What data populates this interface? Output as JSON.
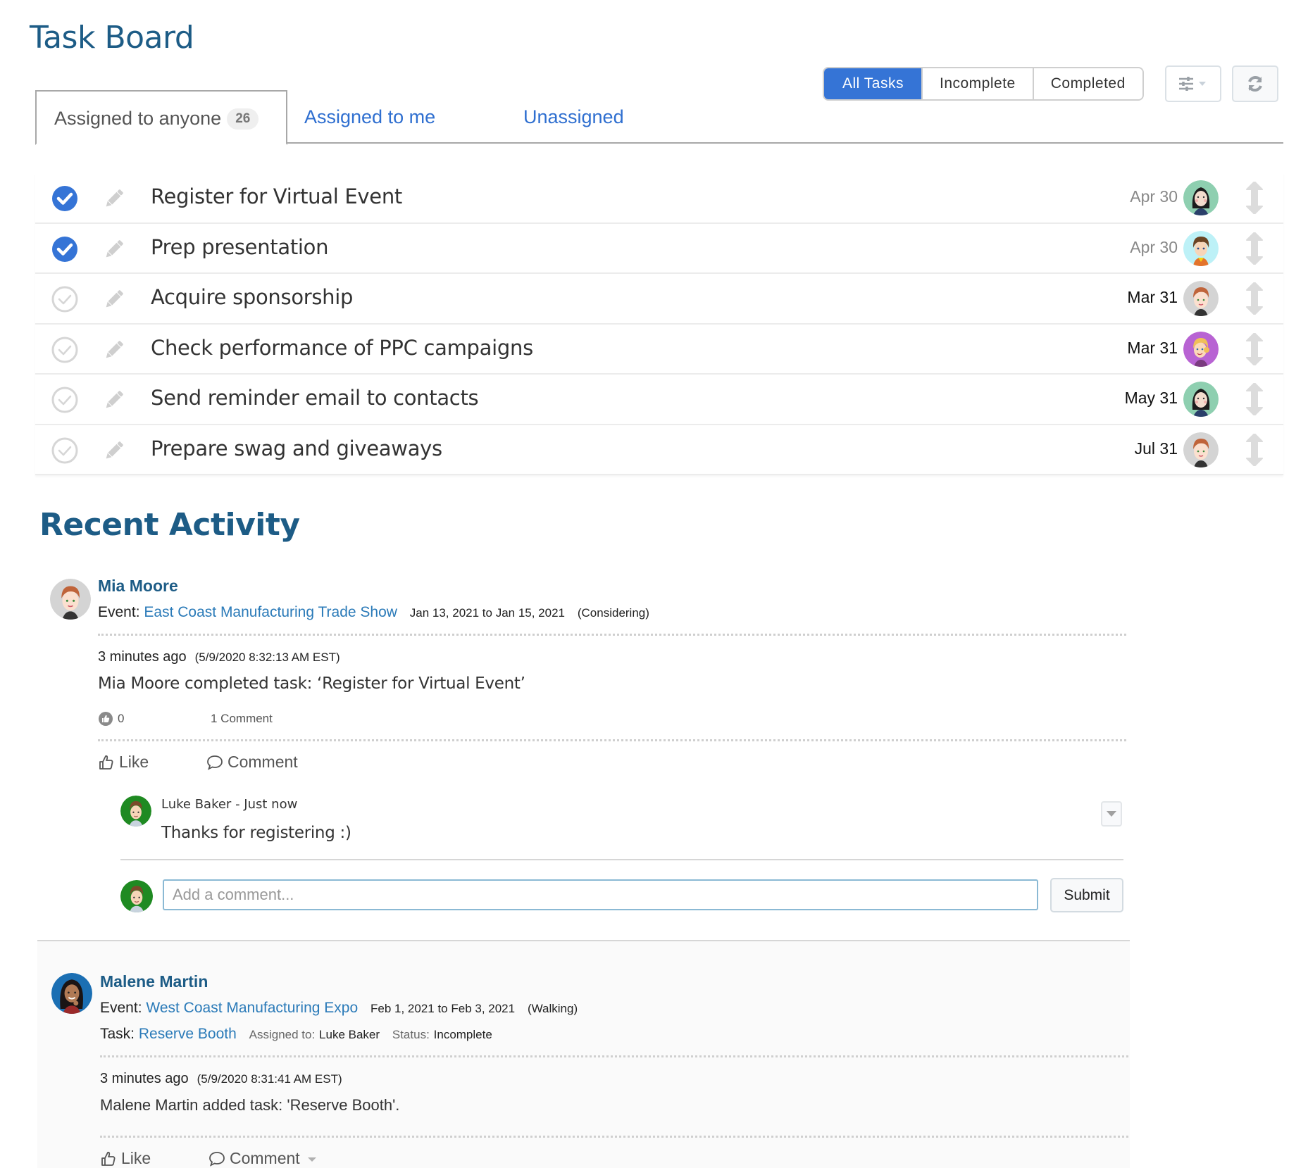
{
  "header": {
    "title": "Task Board"
  },
  "tabs": [
    {
      "label": "Assigned to anyone",
      "count": "26",
      "active": true
    },
    {
      "label": "Assigned to me",
      "active": false
    },
    {
      "label": "Unassigned",
      "active": false
    }
  ],
  "filters": {
    "options": [
      "All Tasks",
      "Incomplete",
      "Completed"
    ],
    "selected": "All Tasks",
    "settings_icon": "sliders-icon",
    "refresh_icon": "refresh-icon"
  },
  "colors": {
    "accent": "#3574d6",
    "heading": "#1d5c86",
    "link": "#2a7ab8",
    "check_done": "#3574d6",
    "check_open": "#d6d6d6"
  },
  "tasks": [
    {
      "title": "Register for Virtual Event",
      "completed": true,
      "due": "Apr 30",
      "assignee_avatar": "woman-black-hair-green-bg"
    },
    {
      "title": "Prep presentation",
      "completed": true,
      "due": "Apr 30",
      "assignee_avatar": "man-brown-hair-cyan-bg"
    },
    {
      "title": "Acquire sponsorship",
      "completed": false,
      "due": "Mar 31",
      "assignee_avatar": "woman-red-hair-gray-bg"
    },
    {
      "title": "Check performance of PPC campaigns",
      "completed": false,
      "due": "Mar 31",
      "assignee_avatar": "woman-blonde-purple-bg"
    },
    {
      "title": "Send reminder email to contacts",
      "completed": false,
      "due": "May 31",
      "assignee_avatar": "woman-black-hair-green-bg"
    },
    {
      "title": "Prepare swag and giveaways",
      "completed": false,
      "due": "Jul 31",
      "assignee_avatar": "woman-red-hair-gray-bg"
    }
  ],
  "recent_activity": {
    "title": "Recent Activity",
    "items": [
      {
        "user": "Mia Moore",
        "event_label": "Event:",
        "event_name": "East Coast Manufacturing Trade Show",
        "event_dates": "Jan 13, 2021 to Jan 15, 2021",
        "event_status": "(Considering)",
        "relative_time": "3 minutes ago",
        "timestamp": "(5/9/2020 8:32:13 AM EST)",
        "message": "Mia Moore completed task: ‘Register for Virtual Event’",
        "likes": "0",
        "comment_count": "1 Comment",
        "like_label": "Like",
        "comment_label": "Comment",
        "comments": [
          {
            "author": "Luke Baker",
            "separator": " - ",
            "time": "Just now",
            "text": "Thanks for registering :)"
          }
        ],
        "compose": {
          "placeholder": "Add a comment...",
          "submit_label": "Submit"
        }
      },
      {
        "user": "Malene Martin",
        "event_label": "Event:",
        "event_name": "West Coast Manufacturing Expo",
        "event_dates": "Feb 1, 2021 to Feb 3, 2021",
        "event_status": "(Walking)",
        "task_label": "Task:",
        "task_name": "Reserve Booth",
        "assigned_label": "Assigned to:",
        "assigned_to": "Luke Baker",
        "status_label": "Status:",
        "status": "Incomplete",
        "relative_time": "3 minutes ago",
        "timestamp": "(5/9/2020 8:31:41 AM EST)",
        "message": "Malene Martin added task: 'Reserve Booth'.",
        "like_label": "Like",
        "comment_label": "Comment"
      }
    ]
  }
}
